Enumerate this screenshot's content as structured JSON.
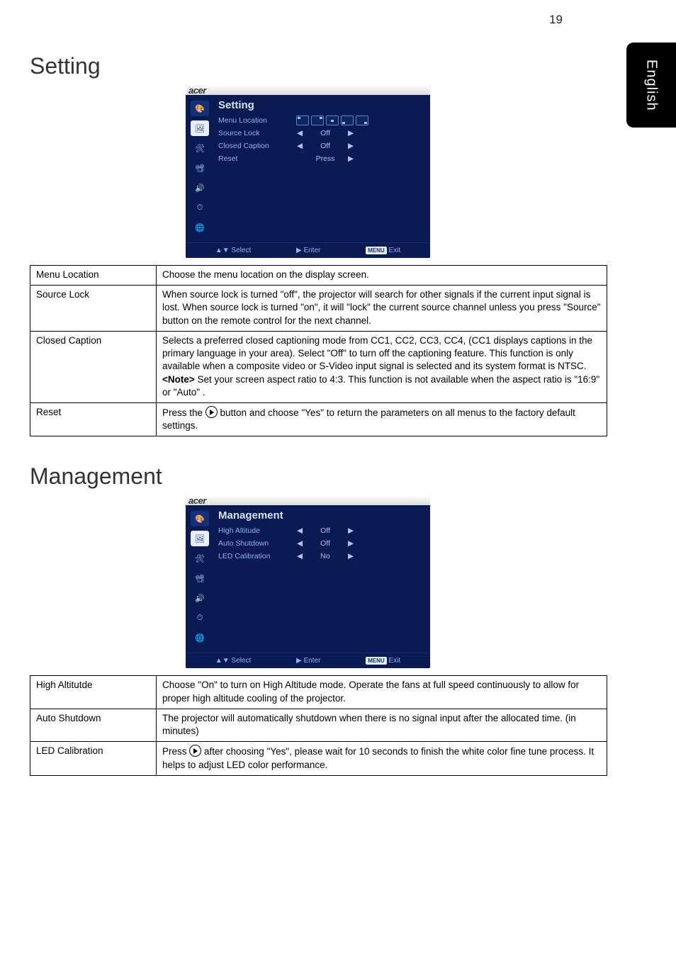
{
  "page_number": "19",
  "side_tab": "English",
  "section1": {
    "title": "Setting"
  },
  "osd1": {
    "brand": "acer",
    "title": "Setting",
    "rows": {
      "r0": {
        "label": "Menu Location"
      },
      "r1": {
        "label": "Source Lock",
        "left": "◀",
        "value": "Off",
        "right": "▶"
      },
      "r2": {
        "label": "Closed Caption",
        "left": "◀",
        "value": "Off",
        "right": "▶"
      },
      "r3": {
        "label": "Reset",
        "value": "Press",
        "right": "▶"
      }
    },
    "bottom": {
      "select": "▲▼ Select",
      "enter": "▶ Enter",
      "menu_label": "MENU",
      "exit": "Exit"
    }
  },
  "table1": {
    "r0": {
      "key": "Menu Location",
      "val": "Choose the menu location on the display screen."
    },
    "r1": {
      "key": "Source Lock",
      "val": "When source lock is turned \"off\", the projector will search for other signals if the current input signal is lost. When source lock is turned \"on\", it will \"lock\" the current source channel unless you press \"Source\" button on the remote control for the next channel."
    },
    "r2": {
      "key": "Closed Caption",
      "val_a": "Selects a preferred closed captioning mode from CC1, CC2, CC3, CC4, (CC1 displays captions in the primary language in your area). Select \"Off\" to turn off the captioning feature. This function is only available when a composite video or S-Video input signal is selected and its system format is NTSC.",
      "val_b_pre": "<Note>",
      "val_b": " Set your screen aspect ratio to 4:3. This function is not available when the aspect ratio is \"16:9\" or \"Auto\" ."
    },
    "r3": {
      "key": "Reset",
      "val_pre": "Press the ",
      "val_post": " button and choose \"Yes\" to return the  parameters on all menus to the factory default settings."
    }
  },
  "section2": {
    "title": "Management"
  },
  "osd2": {
    "brand": "acer",
    "title": "Management",
    "rows": {
      "r0": {
        "label": "High Altitude",
        "left": "◀",
        "value": "Off",
        "right": "▶"
      },
      "r1": {
        "label": "Auto Shutdown",
        "left": "◀",
        "value": "Off",
        "right": "▶"
      },
      "r2": {
        "label": "LED Calibration",
        "left": "◀",
        "value": "No",
        "right": "▶"
      }
    },
    "bottom": {
      "select": "▲▼ Select",
      "enter": "▶ Enter",
      "menu_label": "MENU",
      "exit": "Exit"
    }
  },
  "table2": {
    "r0": {
      "key": "High Altitutde",
      "val": "Choose \"On\" to turn on High Altitude mode. Operate the fans at full speed continuously to allow for proper high altitude cooling of the projector."
    },
    "r1": {
      "key": "Auto Shutdown",
      "val": "The projector will automatically shutdown when there is no signal input after the allocated time. (in minutes)"
    },
    "r2": {
      "key": "LED Calibration",
      "val_pre": "Press ",
      "val_post": " after choosing \"Yes\", please wait for 10 seconds to finish the white color fine tune process. It helps to adjust LED color performance."
    }
  }
}
